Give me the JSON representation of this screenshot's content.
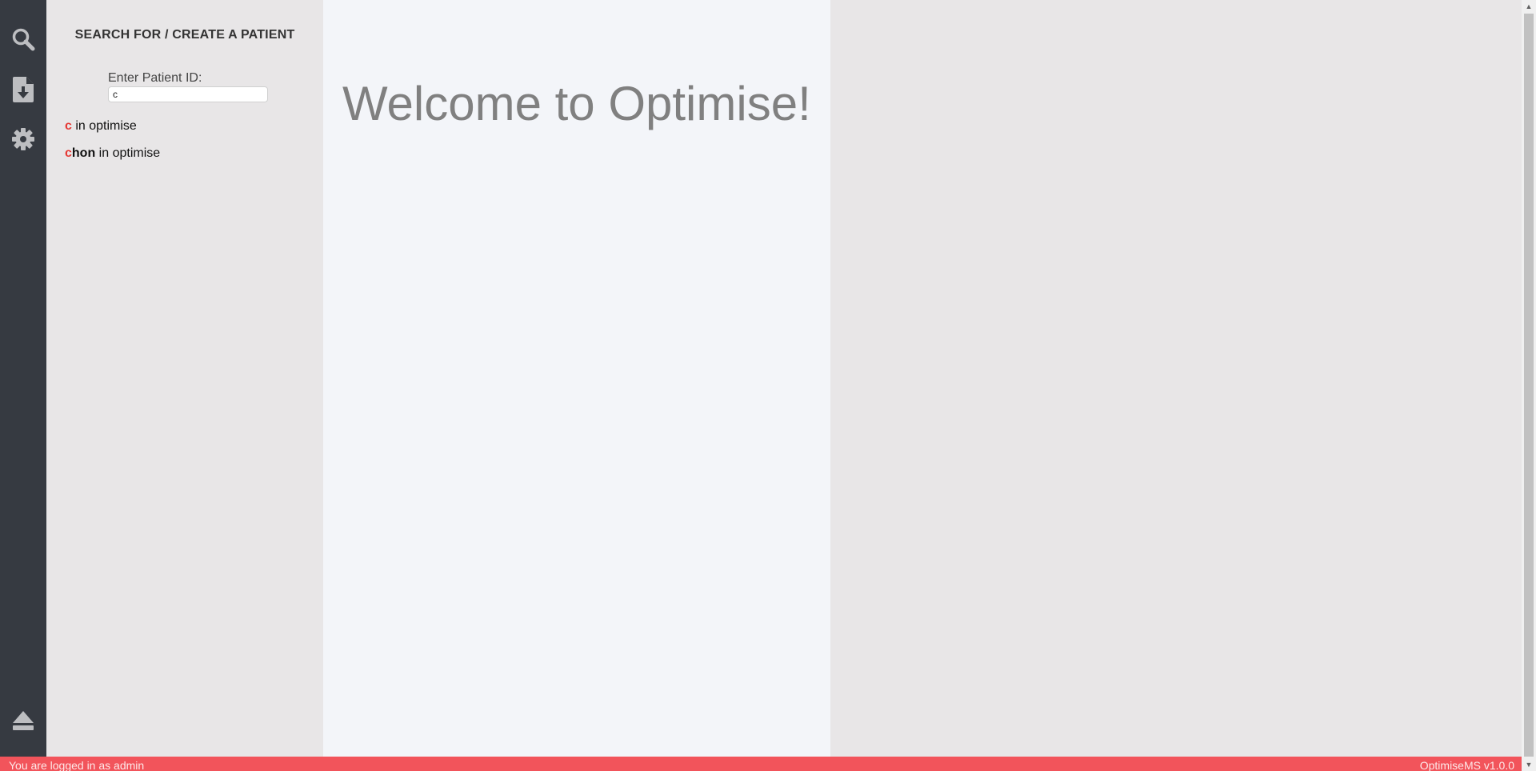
{
  "sidebar": {
    "icons": [
      {
        "name": "search-icon"
      },
      {
        "name": "export-icon"
      },
      {
        "name": "gear-icon"
      },
      {
        "name": "eject-icon"
      }
    ]
  },
  "search_panel": {
    "title": "SEARCH FOR / CREATE A PATIENT",
    "field_label": "Enter Patient ID:",
    "input_value": "c",
    "results": [
      {
        "match": "c",
        "rest": "",
        "suffix": " in optimise"
      },
      {
        "match": "c",
        "rest": "hon",
        "suffix": " in optimise"
      }
    ]
  },
  "main": {
    "welcome": "Welcome to Optimise!"
  },
  "statusbar": {
    "left": "You are logged in as admin",
    "right": "OptimiseMS v1.0.0"
  },
  "colors": {
    "sidebar_bg": "#363a41",
    "panel_bg": "#e8e6e7",
    "main_bg": "#f3f5f9",
    "status_bg": "#f2545b",
    "match_red": "#e53935"
  }
}
